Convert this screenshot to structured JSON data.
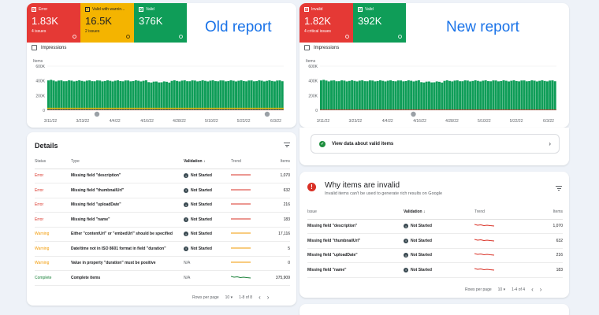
{
  "old_report": {
    "title": "Old report",
    "tiles": [
      {
        "label": "Error",
        "value": "1.83K",
        "sub": "4 issues",
        "color": "#e53935"
      },
      {
        "label": "Valid with warnin...",
        "value": "16.5K",
        "sub": "2 issues",
        "color": "#f4b400"
      },
      {
        "label": "Valid",
        "value": "376K",
        "sub": "",
        "color": "#0f9d58"
      }
    ],
    "impressions_label": "Impressions",
    "chart_ylabel": "Items",
    "details": {
      "title": "Details",
      "columns": [
        "Status",
        "Type",
        "Validation",
        "Trend",
        "Items"
      ],
      "rows": [
        {
          "status": "Error",
          "type": "Missing field \"description\"",
          "validation": "Not Started",
          "items": "1,070",
          "trend_color": "#d93025"
        },
        {
          "status": "Error",
          "type": "Missing field \"thumbnailUrl\"",
          "validation": "Not Started",
          "items": "632",
          "trend_color": "#d93025"
        },
        {
          "status": "Error",
          "type": "Missing field \"uploadDate\"",
          "validation": "Not Started",
          "items": "216",
          "trend_color": "#d93025"
        },
        {
          "status": "Error",
          "type": "Missing field \"name\"",
          "validation": "Not Started",
          "items": "183",
          "trend_color": "#d93025"
        },
        {
          "status": "Warning",
          "type": "Either \"contentUrl\" or \"embedUrl\" should be specified",
          "validation": "Not Started",
          "items": "17,116",
          "trend_color": "#f29900"
        },
        {
          "status": "Warning",
          "type": "Date/time not in ISO 8601 format in field \"duration\"",
          "validation": "Not Started",
          "items": "5",
          "trend_color": "#f29900"
        },
        {
          "status": "Warning",
          "type": "Value in property \"duration\" must be positive",
          "validation": "N/A",
          "items": "0",
          "trend_color": "#f29900"
        },
        {
          "status": "Complete",
          "type": "Complete items",
          "validation": "N/A",
          "items": "375,909",
          "trend_color": "#188038"
        }
      ],
      "rows_per_page_label": "Rows per page",
      "rows_per_page": "10",
      "range": "1-8 of 8"
    }
  },
  "new_report": {
    "title": "New report",
    "tiles": [
      {
        "label": "Invalid",
        "value": "1.82K",
        "sub": "4 critical issues",
        "color": "#e53935"
      },
      {
        "label": "Valid",
        "value": "392K",
        "sub": "",
        "color": "#0f9d58"
      }
    ],
    "impressions_label": "Impressions",
    "chart_ylabel": "Items",
    "valid_link": "View data about valid items",
    "invalid": {
      "title": "Why items are invalid",
      "subtitle": "Invalid items can't be used to generate rich results on Google",
      "columns": [
        "Issue",
        "Validation",
        "Trend",
        "Items"
      ],
      "rows": [
        {
          "type": "Missing field \"description\"",
          "validation": "Not Started",
          "items": "1,070"
        },
        {
          "type": "Missing field \"thumbnailUrl\"",
          "validation": "Not Started",
          "items": "632"
        },
        {
          "type": "Missing field \"uploadDate\"",
          "validation": "Not Started",
          "items": "216"
        },
        {
          "type": "Missing field \"name\"",
          "validation": "Not Started",
          "items": "183"
        }
      ],
      "rows_per_page_label": "Rows per page",
      "rows_per_page": "10",
      "range": "1-4 of 4"
    }
  },
  "chart_data": [
    {
      "type": "bar",
      "ylabel": "Items",
      "ylim": [
        0,
        600000
      ],
      "yticks": [
        "600K",
        "400K",
        "200K",
        "0"
      ],
      "xticks": [
        "3/11/22",
        "3/23/22",
        "4/4/22",
        "4/16/22",
        "4/28/22",
        "5/10/22",
        "5/22/22",
        "6/3/22"
      ],
      "valid_level": 400000,
      "warning_level": 17000,
      "error_level": 2000,
      "annotations": 2
    },
    {
      "type": "bar",
      "ylabel": "Items",
      "ylim": [
        0,
        600000
      ],
      "yticks": [
        "600K",
        "400K",
        "200K",
        "0"
      ],
      "xticks": [
        "3/11/22",
        "3/23/22",
        "4/4/22",
        "4/16/22",
        "4/28/22",
        "5/10/22",
        "5/22/22",
        "6/3/22"
      ],
      "valid_level": 400000,
      "error_level": 2000,
      "annotations": 1
    }
  ],
  "icons": {
    "checkbox": "check-icon",
    "info": "info-icon",
    "filter": "filter-icon",
    "sort": "arrow-down-icon",
    "not_started": "info-dot-icon",
    "valid": "check-circle-icon",
    "alert": "alert-icon",
    "chevron": "chevron-right-icon",
    "pagination": "chevron-left-right-icons"
  },
  "glyphs": {
    "check": "✓",
    "sort": "↓",
    "info": "i",
    "alert": "!",
    "chevron_right": "›",
    "chevron_left": "‹",
    "dropdown": "▾"
  }
}
